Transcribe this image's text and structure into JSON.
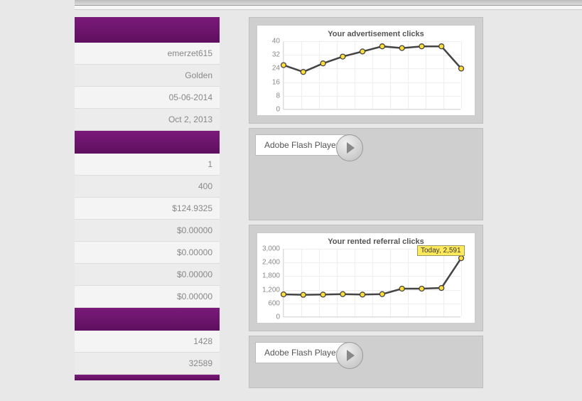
{
  "sidebar": {
    "section1": {
      "rows": [
        {
          "value": "emerzet615"
        },
        {
          "value": "Golden"
        },
        {
          "value": "05-06-2014"
        },
        {
          "value": "Oct 2, 2013"
        }
      ]
    },
    "section2": {
      "rows": [
        {
          "value": "1"
        },
        {
          "value": "400"
        },
        {
          "value": "$124.9325"
        },
        {
          "value": "$0.00000"
        },
        {
          "value": "$0.00000"
        },
        {
          "value": "$0.00000"
        },
        {
          "value": "$0.00000"
        }
      ]
    },
    "section3": {
      "rows": [
        {
          "value": "1428"
        },
        {
          "value": "32589"
        }
      ]
    }
  },
  "flash": {
    "label": "Adobe Flash Player"
  },
  "chart_data": [
    {
      "type": "line",
      "title": "Your advertisement clicks",
      "ylabel": "",
      "xlabel": "",
      "ylim": [
        0,
        40
      ],
      "yticks": [
        0,
        8,
        16,
        24,
        32,
        40
      ],
      "x": [
        0,
        1,
        2,
        3,
        4,
        5,
        6,
        7,
        8,
        9
      ],
      "values": [
        26,
        22,
        27,
        31,
        34,
        37,
        36,
        37,
        37,
        24
      ],
      "n_vgrid": 10
    },
    {
      "type": "line",
      "title": "Your rented referral clicks",
      "ylabel": "",
      "xlabel": "",
      "ylim": [
        0,
        3000
      ],
      "yticks": [
        0,
        600,
        1200,
        1800,
        2400,
        3000
      ],
      "x": [
        0,
        1,
        2,
        3,
        4,
        5,
        6,
        7,
        8,
        9
      ],
      "values": [
        1000,
        980,
        990,
        1010,
        990,
        1010,
        1250,
        1250,
        1280,
        2591
      ],
      "n_vgrid": 10,
      "tooltip": {
        "label": "Today, 2,591",
        "point_index": 9
      }
    }
  ]
}
